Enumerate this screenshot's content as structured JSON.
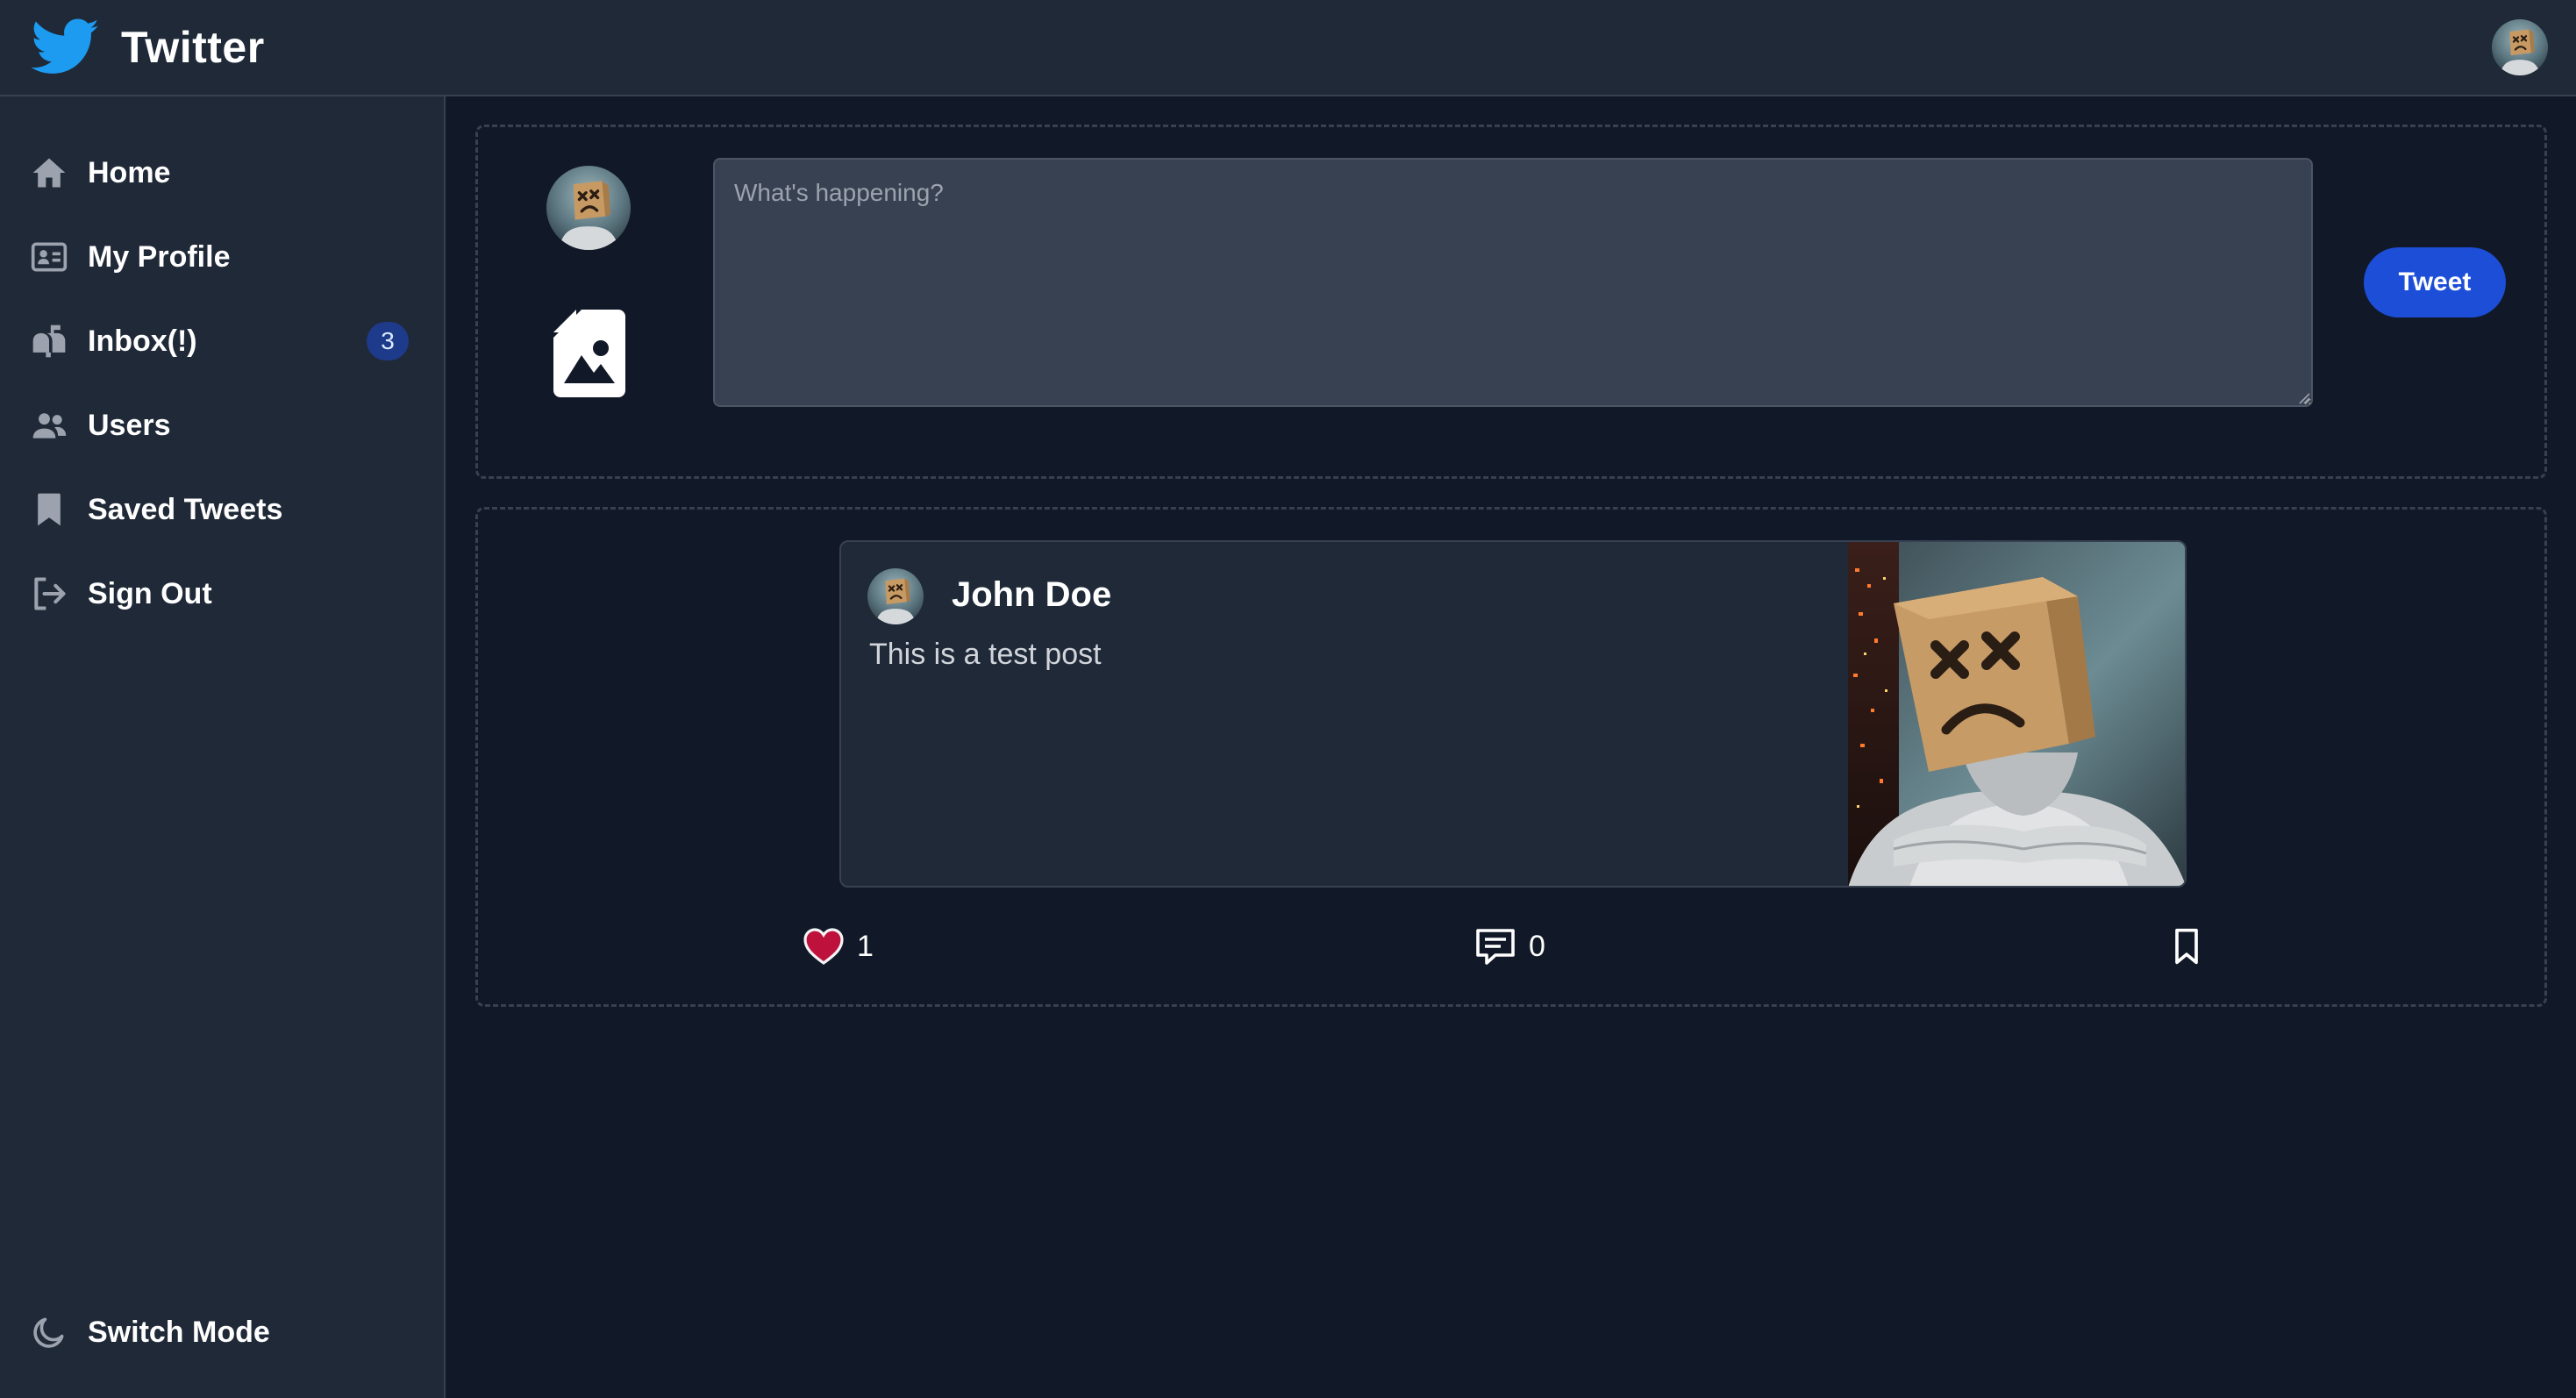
{
  "app": {
    "title": "Twitter"
  },
  "header": {
    "avatar_icon": "user-avatar"
  },
  "sidebar": {
    "items": [
      {
        "label": "Home",
        "icon": "home-icon"
      },
      {
        "label": "My Profile",
        "icon": "id-card-icon"
      },
      {
        "label": "Inbox(!)",
        "icon": "mailbox-icon",
        "badge": "3"
      },
      {
        "label": "Users",
        "icon": "users-icon"
      },
      {
        "label": "Saved Tweets",
        "icon": "bookmark-icon"
      },
      {
        "label": "Sign Out",
        "icon": "sign-out-icon"
      }
    ],
    "footer": {
      "label": "Switch Mode",
      "icon": "moon-icon"
    }
  },
  "composer": {
    "placeholder": "What's happening?",
    "value": "",
    "submit_label": "Tweet",
    "attach_icon": "image-file-icon"
  },
  "feed": {
    "posts": [
      {
        "author": "John Doe",
        "text": "This is a test post",
        "likes": "1",
        "comments": "0",
        "liked": true
      }
    ]
  },
  "colors": {
    "background": "#111827",
    "panel": "#1f2937",
    "border": "#374151",
    "accent": "#1d4ed8",
    "twitter_blue": "#1d9bf0",
    "like": "#be123c",
    "badge": "#1e3a8a"
  }
}
